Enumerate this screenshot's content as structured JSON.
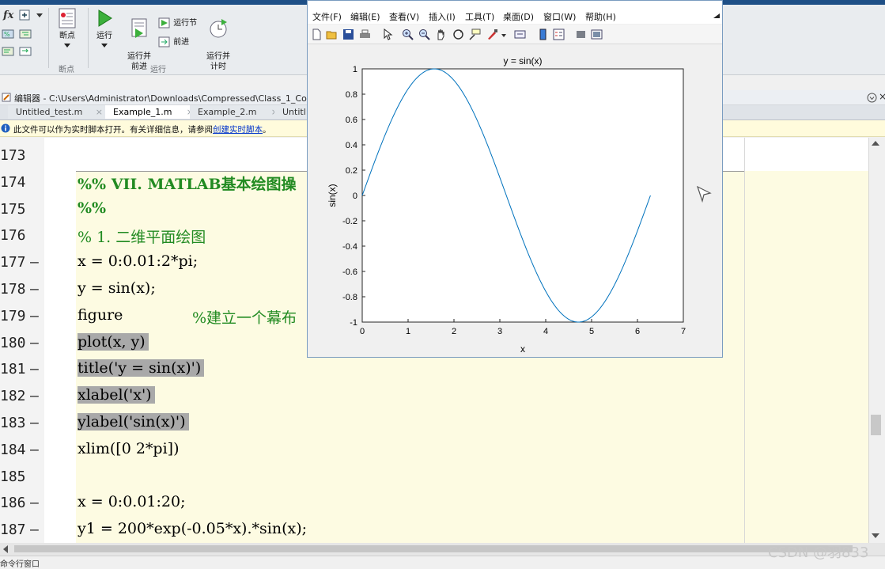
{
  "ribbon": {
    "buttons": {
      "breakpoints": "断点",
      "run": "运行",
      "run_and_advance": "运行并\n前进",
      "run_section": "运行节",
      "advance": "前进",
      "run_and_time": "运行并\n计时"
    },
    "groups": {
      "breakpoints": "断点",
      "run": "运行"
    },
    "fx": "fx"
  },
  "editor": {
    "title": "编辑器 - C:\\Users\\Administrator\\Downloads\\Compressed\\Class_1_Co",
    "tabs": [
      "Untitled_test.m",
      "Example_1.m",
      "Example_2.m",
      "Untitl"
    ],
    "active_tab": 1,
    "info_text": "此文件可以作为实时脚本打开。有关详细信息，请参阅",
    "info_link": "创建实时脚本",
    "info_end": "。",
    "lines": [
      {
        "num": "173",
        "dash": "",
        "code": "",
        "style": ""
      },
      {
        "num": "174",
        "dash": "",
        "code": "%% VII. MATLAB基本绘图操",
        "style": "comment bold"
      },
      {
        "num": "175",
        "dash": "",
        "code": "%%",
        "style": "comment bold"
      },
      {
        "num": "176",
        "dash": "",
        "code": "% 1. 二维平面绘图",
        "style": "comment"
      },
      {
        "num": "177",
        "dash": "—",
        "code": "x = 0:0.01:2*pi;",
        "style": ""
      },
      {
        "num": "178",
        "dash": "—",
        "code": "y = sin(x);",
        "style": ""
      },
      {
        "num": "179",
        "dash": "—",
        "code": "figure       ",
        "comment": "%建立一个幕布",
        "style": ""
      },
      {
        "num": "180",
        "dash": "—",
        "code": "plot(x, y)",
        "style": "hl"
      },
      {
        "num": "181",
        "dash": "—",
        "code": "title('y = sin(x)')",
        "style": "hl"
      },
      {
        "num": "182",
        "dash": "—",
        "code": "xlabel('x')",
        "style": "hl"
      },
      {
        "num": "183",
        "dash": "—",
        "code": "ylabel('sin(x)')",
        "style": "hl"
      },
      {
        "num": "184",
        "dash": "—",
        "code": "xlim([0 2*pi])",
        "style": ""
      },
      {
        "num": "185",
        "dash": "",
        "code": "",
        "style": ""
      },
      {
        "num": "186",
        "dash": "—",
        "code": "x = 0:0.01:20;",
        "style": ""
      },
      {
        "num": "187",
        "dash": "—",
        "code": "y1 = 200*exp(-0.05*x).*sin(x);",
        "style": ""
      }
    ]
  },
  "figure_window": {
    "menu": [
      "文件(F)",
      "编辑(E)",
      "查看(V)",
      "插入(I)",
      "工具(T)",
      "桌面(D)",
      "窗口(W)",
      "帮助(H)"
    ],
    "toolbar_icons": [
      "new-figure-icon",
      "open-icon",
      "save-icon",
      "print-icon",
      "pointer-icon",
      "zoom-in-icon",
      "zoom-out-icon",
      "pan-icon",
      "rotate-icon",
      "data-cursor-icon",
      "brush-icon",
      "link-icon",
      "colorbar-icon",
      "legend-icon",
      "hide-plot-tools-icon",
      "show-plot-tools-icon"
    ]
  },
  "chart_data": {
    "type": "line",
    "title": "y = sin(x)",
    "xlabel": "x",
    "ylabel": "sin(x)",
    "xlim": [
      0,
      7
    ],
    "ylim": [
      -1,
      1
    ],
    "xticks": [
      "0",
      "1",
      "2",
      "3",
      "4",
      "5",
      "6",
      "7"
    ],
    "yticks": [
      "-1",
      "-0.8",
      "-0.6",
      "-0.4",
      "-0.2",
      "0",
      "0.2",
      "0.4",
      "0.6",
      "0.8",
      "1"
    ],
    "series": [
      {
        "color": "#0072bd",
        "x": [
          0,
          0.5,
          1.0,
          1.5708,
          2.0,
          2.5,
          3.1416,
          3.5,
          4.0,
          4.7124,
          5.0,
          5.5,
          6.2832
        ],
        "y": [
          0,
          0.479,
          0.841,
          1.0,
          0.909,
          0.598,
          0,
          -0.351,
          -0.757,
          -1.0,
          -0.959,
          -0.706,
          0
        ]
      }
    ],
    "grid": false
  },
  "command_window_label": "命令行窗口",
  "watermark": "CSDN @羽833"
}
